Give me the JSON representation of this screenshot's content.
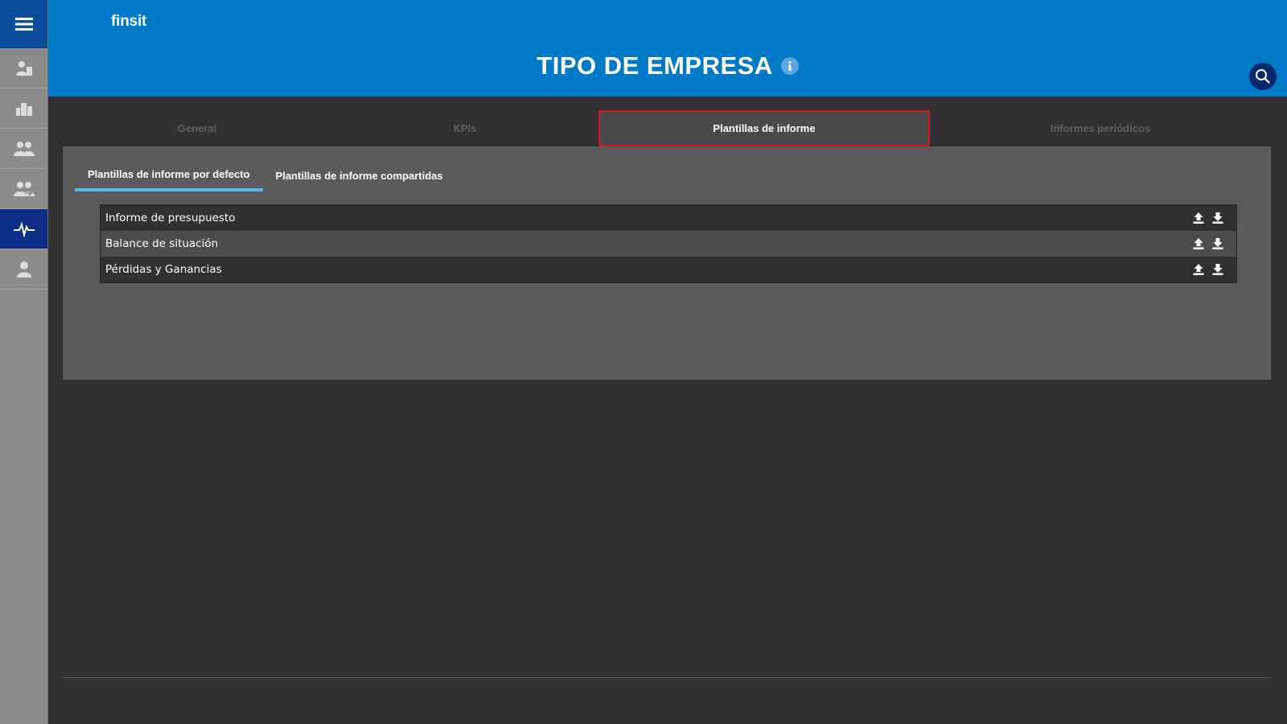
{
  "app": {
    "logo": "finsit"
  },
  "header": {
    "title": "TIPO DE EMPRESA",
    "info_icon": "info-icon",
    "search_icon": "search-icon"
  },
  "sidebar": {
    "menu_icon": "hamburger-menu-icon",
    "items": [
      {
        "id": "clients",
        "icon": "person-building-icon",
        "active": false
      },
      {
        "id": "companies",
        "icon": "buildings-icon",
        "active": false
      },
      {
        "id": "groups",
        "icon": "people-icon",
        "active": false
      },
      {
        "id": "shared-groups",
        "icon": "people-share-icon",
        "active": false
      },
      {
        "id": "activity",
        "icon": "pulse-icon",
        "active": true
      },
      {
        "id": "user",
        "icon": "user-icon",
        "active": false
      }
    ]
  },
  "tabs": [
    {
      "label": "General",
      "active": false
    },
    {
      "label": "KPIs",
      "active": false
    },
    {
      "label": "Plantillas de informe",
      "active": true
    },
    {
      "label": "Informes periódicos",
      "active": false
    }
  ],
  "subtabs": [
    {
      "label": "Plantillas de informe por defecto",
      "active": true
    },
    {
      "label": "Plantillas de informe compartidas",
      "active": false
    }
  ],
  "templates": [
    {
      "name": "Informe de presupuesto"
    },
    {
      "name": "Balance de situación"
    },
    {
      "name": "Pérdidas y Ganancias"
    }
  ],
  "row_actions": {
    "upload_icon": "upload-icon",
    "download_icon": "download-icon"
  },
  "colors": {
    "header": "#0079c6",
    "sidebar_active": "#0b2d86",
    "accent": "#57b7e0",
    "highlight": "#d0151e"
  }
}
